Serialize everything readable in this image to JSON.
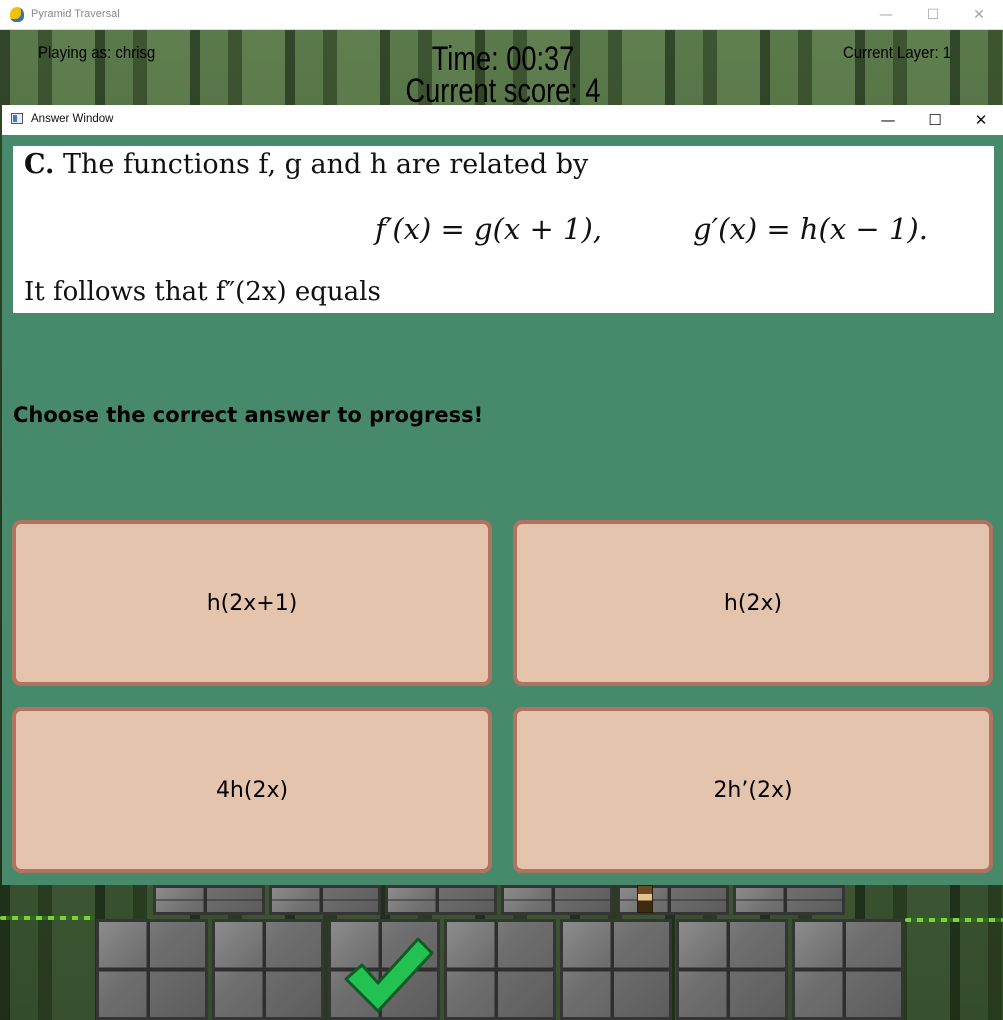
{
  "outer_window": {
    "title": "Pyramid Traversal",
    "controls": {
      "minimize": "—",
      "maximize": "☐",
      "close": "✕"
    }
  },
  "hud": {
    "player": "Playing as: chrisg",
    "timer": "Time: 00:37",
    "score": "Current score: 4",
    "layer": "Current Layer: 1"
  },
  "answer_window": {
    "title": "Answer Window",
    "controls": {
      "minimize": "—",
      "maximize": "☐",
      "close": "✕"
    }
  },
  "question": {
    "label": "C.",
    "line1": "The functions f, g and h are related by",
    "eq_left": "f′(x) = g(x + 1),",
    "eq_right": "g′(x) = h(x − 1).",
    "line3": "It follows that f″(2x) equals"
  },
  "prompt": "Choose the correct answer to progress!",
  "answers": [
    {
      "label": "h(2x+1)"
    },
    {
      "label": "h(2x)"
    },
    {
      "label": "4h(2x)"
    },
    {
      "label": "2h’(2x)"
    }
  ],
  "colors": {
    "window_bg": "#478a6b",
    "answer_bg": "#e4c4ad",
    "answer_border": "#b0735f",
    "checkmark": "#22c152"
  },
  "icons": {
    "check": "checkmark-icon",
    "app": "python-app-icon",
    "player": "explorer-sprite"
  }
}
